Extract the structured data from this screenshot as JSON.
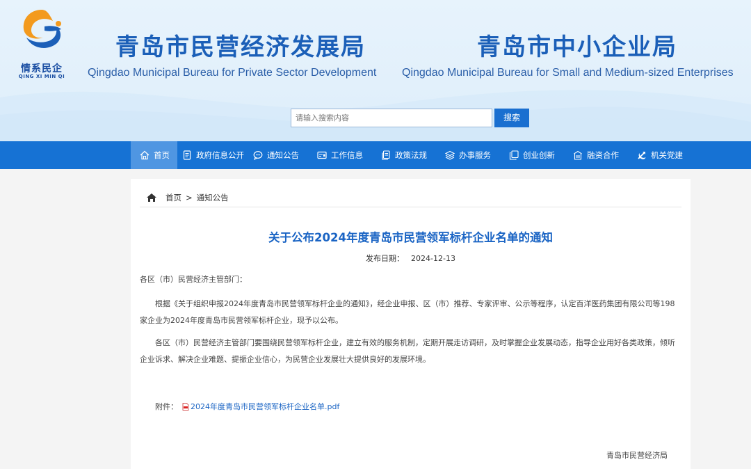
{
  "logo": {
    "name_cn": "情系民企",
    "name_py": "QING XI MIN QI",
    "colors": {
      "orange": "#f39a1e",
      "blue": "#1b5fb8"
    }
  },
  "header": {
    "bureau1_cn": "青岛市民营经济发展局",
    "bureau1_en": "Qingdao Municipal Bureau for Private Sector Development",
    "bureau2_cn": "青岛市中小企业局",
    "bureau2_en": "Qingdao Municipal Bureau for Small and Medium-sized Enterprises"
  },
  "search": {
    "placeholder": "请输入搜索内容",
    "button_label": "搜索"
  },
  "nav": {
    "items": [
      {
        "label": "首页",
        "icon": "home-icon",
        "active": true
      },
      {
        "label": "政府信息公开",
        "icon": "document-icon"
      },
      {
        "label": "通知公告",
        "icon": "chat-icon"
      },
      {
        "label": "工作信息",
        "icon": "card-icon"
      },
      {
        "label": "政策法规",
        "icon": "files-icon"
      },
      {
        "label": "办事服务",
        "icon": "layers-icon"
      },
      {
        "label": "创业创新",
        "icon": "copy-icon"
      },
      {
        "label": "融资合作",
        "icon": "building-icon"
      },
      {
        "label": "机关党建",
        "icon": "party-emblem-icon"
      }
    ]
  },
  "breadcrumb": {
    "home": "首页",
    "separator": ">",
    "current": "通知公告"
  },
  "article": {
    "title": "关于公布2024年度青岛市民营领军标杆企业名单的通知",
    "date_label": "发布日期：",
    "date": "2024-12-13",
    "salutation": "各区（市）民营经济主管部门：",
    "paragraph1": "根据《关于组织申报2024年度青岛市民营领军标杆企业的通知》，经企业申报、区（市）推荐、专家评审、公示等程序，认定百洋医药集团有限公司等198家企业为2024年度青岛市民营领军标杆企业，现予以公布。",
    "paragraph2": "各区（市）民营经济主管部门要围绕民营领军标杆企业，建立有效的服务机制，定期开展走访调研，及时掌握企业发展动态，指导企业用好各类政策，倾听企业诉求、解决企业难题、提振企业信心，为民营企业发展壮大提供良好的发展环境。",
    "attachment_label": "附件：",
    "attachment_name": "2024年度青岛市民营领军标杆企业名单.pdf",
    "signature": "青岛市民营经济局"
  }
}
